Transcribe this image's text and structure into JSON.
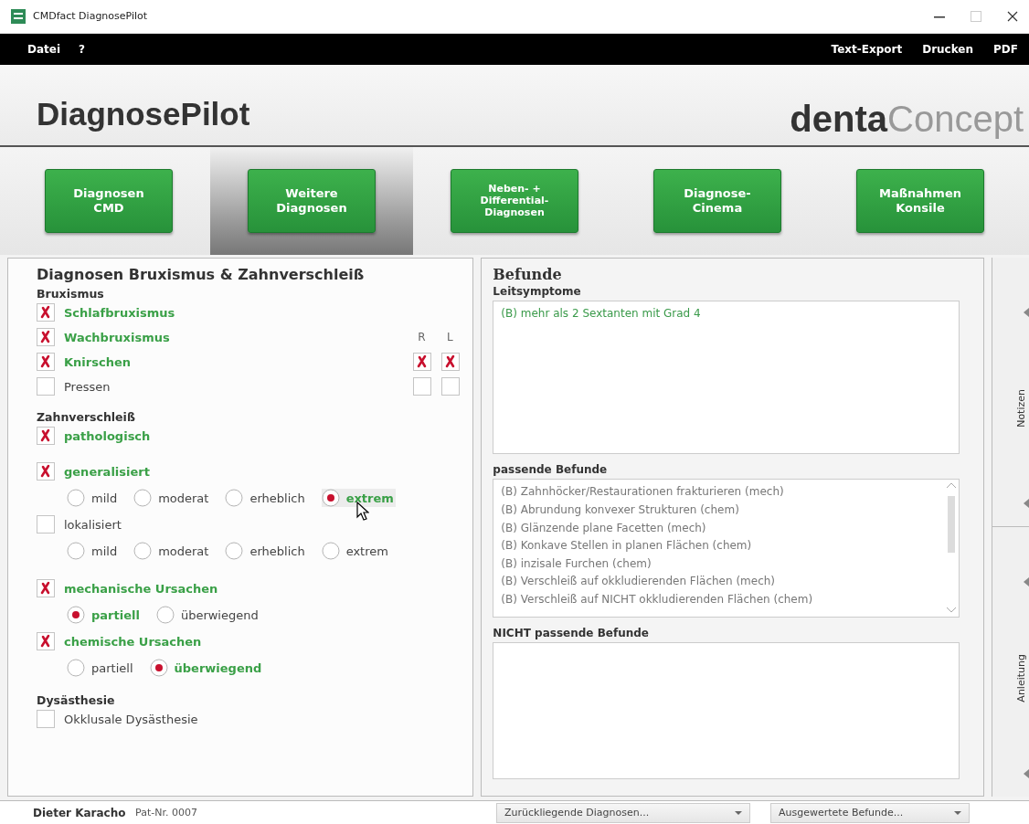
{
  "window": {
    "title": "CMDfact DiagnosePilot"
  },
  "menu": {
    "left": [
      "Datei",
      "?"
    ],
    "right": [
      "Text-Export",
      "Drucken",
      "PDF"
    ]
  },
  "header": {
    "title": "DiagnosePilot",
    "logo": {
      "bold": "denta",
      "light": "Concept"
    }
  },
  "nav": [
    {
      "lines": [
        "Diagnosen",
        "CMD"
      ],
      "selected": false
    },
    {
      "lines": [
        "Weitere",
        "Diagnosen"
      ],
      "selected": true
    },
    {
      "lines": [
        "Neben- +",
        "Differential-",
        "Diagnosen"
      ],
      "selected": false
    },
    {
      "lines": [
        "Diagnose-",
        "Cinema"
      ],
      "selected": false
    },
    {
      "lines": [
        "Maßnahmen",
        "Konsile"
      ],
      "selected": false
    }
  ],
  "diagnoses": {
    "title": "Diagnosen Bruxismus & Zahnverschleiß",
    "sections": [
      {
        "heading": "Bruxismus",
        "side_labels": [
          "R",
          "L"
        ],
        "groups": [
          [
            {
              "kind": "check",
              "label": "Schlafbruxismus",
              "checked": true
            },
            {
              "kind": "check",
              "label": "Wachbruxismus",
              "checked": true
            },
            {
              "kind": "check",
              "label": "Knirschen",
              "checked": true,
              "sides": [
                {
                  "checked": true
                },
                {
                  "checked": true
                }
              ]
            },
            {
              "kind": "check",
              "label": "Pressen",
              "checked": false,
              "sides": [
                {
                  "checked": false
                },
                {
                  "checked": false
                }
              ]
            }
          ]
        ]
      },
      {
        "heading": "Zahnverschleiß",
        "groups": [
          [
            {
              "kind": "check",
              "label": "pathologisch",
              "checked": true
            }
          ],
          [
            {
              "kind": "check",
              "label": "generalisiert",
              "checked": true
            },
            {
              "kind": "radio",
              "options": [
                {
                  "label": "mild",
                  "selected": false
                },
                {
                  "label": "moderat",
                  "selected": false
                },
                {
                  "label": "erheblich",
                  "selected": false
                },
                {
                  "label": "extrem",
                  "selected": true,
                  "hovered": true
                }
              ]
            },
            {
              "kind": "check",
              "label": "lokalisiert",
              "checked": false
            },
            {
              "kind": "radio",
              "options": [
                {
                  "label": "mild",
                  "selected": false
                },
                {
                  "label": "moderat",
                  "selected": false
                },
                {
                  "label": "erheblich",
                  "selected": false
                },
                {
                  "label": "extrem",
                  "selected": false
                }
              ]
            }
          ],
          [
            {
              "kind": "check",
              "label": "mechanische Ursachen",
              "checked": true
            },
            {
              "kind": "radio",
              "options": [
                {
                  "label": "partiell",
                  "selected": true
                },
                {
                  "label": "überwiegend",
                  "selected": false
                }
              ]
            },
            {
              "kind": "check",
              "label": "chemische Ursachen",
              "checked": true
            },
            {
              "kind": "radio",
              "options": [
                {
                  "label": "partiell",
                  "selected": false
                },
                {
                  "label": "überwiegend",
                  "selected": true
                }
              ]
            }
          ]
        ]
      },
      {
        "heading": "Dysästhesie",
        "groups": [
          [
            {
              "kind": "check",
              "label": "Okklusale Dysästhesie",
              "checked": false
            }
          ]
        ]
      }
    ]
  },
  "findings": {
    "title": "Befunde",
    "boxes": [
      {
        "label": "Leitsymptome",
        "kind": "lead",
        "items": [
          "(B) mehr als 2 Sextanten mit Grad 4"
        ]
      },
      {
        "label": "passende Befunde",
        "kind": "scroll",
        "items": [
          "(B) Zahnhöcker/Restaurationen frakturieren (mech)",
          "(B) Abrundung konvexer Strukturen (chem)",
          "(B) Glänzende plane Facetten (mech)",
          "(B) Konkave Stellen in planen Flächen (chem)",
          "(B) inzisale Furchen (chem)",
          "(B) Verschleiß auf okkludierenden Flächen (mech)",
          "(B) Verschleiß auf NICHT okkludierenden Flächen (chem)"
        ]
      },
      {
        "label": "NICHT passende Befunde",
        "kind": "plain"
      }
    ]
  },
  "side_tabs": [
    {
      "label": "Notizen"
    },
    {
      "label": "Anleitung"
    }
  ],
  "status": {
    "patient": "Dieter Karacho",
    "patient_no": "Pat-Nr. 0007",
    "dropdowns": [
      "Zurückliegende Diagnosen...",
      "Ausgewertete Befunde..."
    ]
  }
}
